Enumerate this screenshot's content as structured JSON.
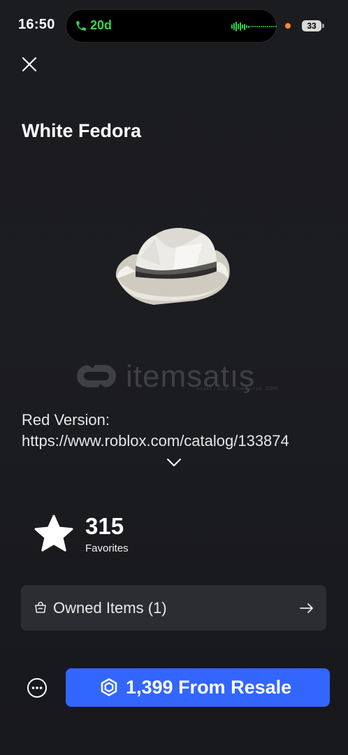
{
  "status_bar": {
    "time": "16:50",
    "call_duration": "20d",
    "battery": "33"
  },
  "item": {
    "title": "White Fedora",
    "description_line1": "Red Version:",
    "description_line2": "https://www.roblox.com/catalog/133874",
    "favorites_count": "315",
    "favorites_label": "Favorites"
  },
  "watermark": {
    "text": "itemsatış",
    "tagline": "HESAP | SKIN | ITEM | OYUN",
    "domain": ".com"
  },
  "owned_items": {
    "label": "Owned Items (1)"
  },
  "buy_button": {
    "label": "1,399 From Resale"
  },
  "icons": {
    "close": "close-icon",
    "expand": "chevron-down-icon",
    "favorites": "star-icon",
    "owned": "bag-icon",
    "owned_arrow": "arrow-right-icon",
    "more": "more-options-icon",
    "currency": "robux-icon"
  },
  "colors": {
    "accent": "#3366ff",
    "call_green": "#37d34f",
    "card_bg": "#2c2d32"
  }
}
